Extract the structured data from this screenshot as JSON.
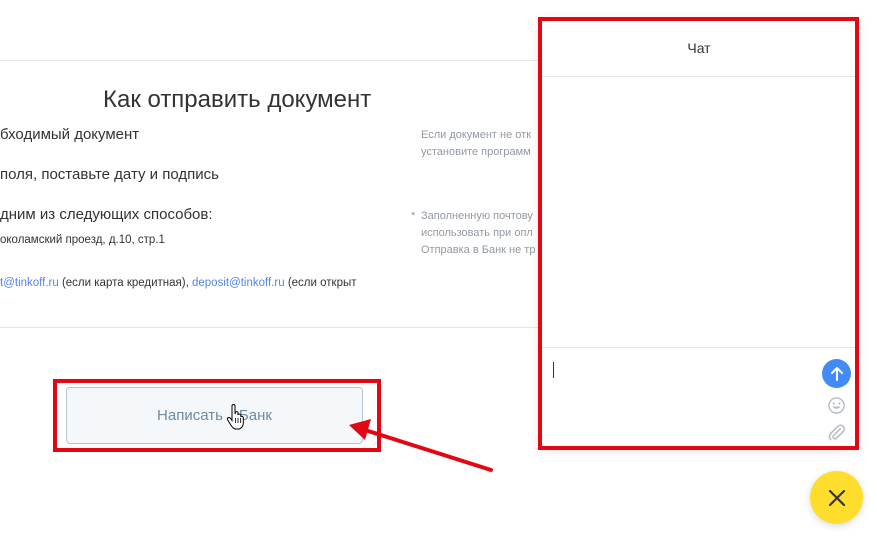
{
  "page": {
    "title": "Как отправить документ",
    "steps": {
      "step1": "бходимый документ",
      "step2": "поля, поставьте дату и подпись",
      "step3": "дним из следующих способов:",
      "address": "околамский проезд, д.10, стр.1",
      "email_credit_link": "t@tinkoff.ru",
      "email_credit_note": " (если карта кредитная), ",
      "email_deposit_link": "deposit@tinkoff.ru",
      "email_deposit_note": " (если открыт"
    },
    "notes": {
      "note1_line1": "Если документ не отк",
      "note1_line2": "установите программ",
      "star": "*",
      "note2_line1": "Заполненную почтову",
      "note2_line2": "использовать при опл",
      "note2_line3": "Отправка в Банк не тр"
    },
    "write_button": {
      "label_prefix": "Написать",
      "label_suffix": "Банк"
    }
  },
  "chat": {
    "title": "Чат",
    "input_value": "",
    "send_icon": "arrow-up-icon",
    "emoji_icon": "smile-icon",
    "attach_icon": "paperclip-icon"
  },
  "close_fab": {
    "icon": "close-icon"
  },
  "colors": {
    "annotation_red": "#e30613",
    "send_blue": "#428bf9",
    "fab_yellow": "#ffdd2d",
    "link_blue": "#336fee"
  }
}
